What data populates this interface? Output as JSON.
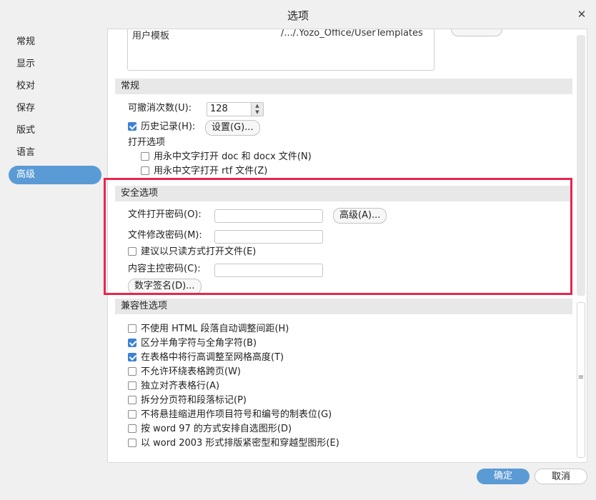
{
  "window": {
    "title": "选项"
  },
  "sidebar": {
    "items": [
      {
        "label": "常规"
      },
      {
        "label": "显示"
      },
      {
        "label": "校对"
      },
      {
        "label": "保存"
      },
      {
        "label": "版式"
      },
      {
        "label": "语言"
      },
      {
        "label": "高级",
        "active": true
      }
    ]
  },
  "file_locations": {
    "template_name": "用户模板",
    "template_path": "/.../.Yozo_Office/UserTemplates"
  },
  "general": {
    "header": "常规",
    "undo_label": "可撤消次数(U):",
    "undo_value": "128",
    "history_label": "历史记录(H):",
    "history_checked": true,
    "settings_button": "设置(G)...",
    "open_options_label": "打开选项",
    "open_doc_label": "用永中文字打开 doc 和 docx 文件(N)",
    "open_rtf_label": "用永中文字打开 rtf 文件(Z)"
  },
  "security": {
    "header": "安全选项",
    "open_password_label": "文件打开密码(O):",
    "advanced_button": "高级(A)...",
    "modify_password_label": "文件修改密码(M):",
    "readonly_label": "建议以只读方式打开文件(E)",
    "master_password_label": "内容主控密码(C):",
    "digital_signature_button": "数字签名(D)..."
  },
  "compatibility": {
    "header": "兼容性选项",
    "options": [
      {
        "label": "不使用 HTML 段落自动调整间距(H)",
        "checked": false
      },
      {
        "label": "区分半角字符与全角字符(B)",
        "checked": true
      },
      {
        "label": "在表格中将行高调整至网格高度(T)",
        "checked": true
      },
      {
        "label": "不允许环绕表格跨页(W)",
        "checked": false
      },
      {
        "label": "独立对齐表格行(A)",
        "checked": false
      },
      {
        "label": "拆分分页符和段落标记(P)",
        "checked": false
      },
      {
        "label": "不将悬挂缩进用作项目符号和编号的制表位(G)",
        "checked": false
      },
      {
        "label": "按 word 97 的方式安排自选图形(D)",
        "checked": false
      },
      {
        "label": "以 word 2003 形式排版紧密型和穿越型图形(E)",
        "checked": false
      }
    ]
  },
  "footer": {
    "ok_label": "确定",
    "cancel_label": "取消"
  },
  "colors": {
    "accent": "#5b9bd5",
    "highlight": "#e8264e"
  }
}
